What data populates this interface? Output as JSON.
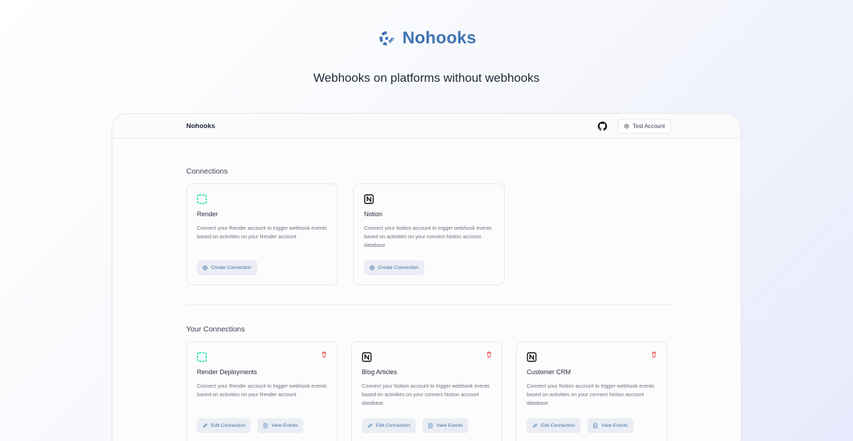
{
  "hero": {
    "brand": "Nohooks",
    "tagline": "Webhooks on platforms without webhooks"
  },
  "nav": {
    "app_name": "Nohooks",
    "github_icon": "github-icon",
    "account_label": "Test Account",
    "account_icon": "settings-icon"
  },
  "connections": {
    "title": "Connections",
    "cards": [
      {
        "logo": "render-logo",
        "name": "Render",
        "description": "Connect your Render account to trigger webhook events based on activities on your Render account",
        "button": "Create Connection"
      },
      {
        "logo": "notion-logo",
        "name": "Notion",
        "description": "Connect your Notion account to trigger webhook events based on activities on your connect Notion account database",
        "button": "Create Connection"
      }
    ]
  },
  "your_connections": {
    "title": "Your Connections",
    "cards": [
      {
        "logo": "render-logo",
        "name": "Render Deployments",
        "description": "Connect your Render account to trigger webhook events based on activities on your Render account",
        "edit": "Edit Connection",
        "view": "View Events"
      },
      {
        "logo": "notion-logo",
        "name": "Blog Articles",
        "description": "Connect your Notion account to trigger webhook events based on activities on your connect Notion account database",
        "edit": "Edit Connection",
        "view": "View Events"
      },
      {
        "logo": "notion-logo",
        "name": "Customer CRM",
        "description": "Connect your Notion account to trigger webhook events based on activities on your connect Notion account database",
        "edit": "Edit Connection",
        "view": "View Events"
      }
    ]
  },
  "colors": {
    "brand": "#3f74b2",
    "render": "#46e3b7",
    "delete": "#ef4444",
    "button_bg": "#eaeef4",
    "button_text": "#3f6ea3"
  }
}
